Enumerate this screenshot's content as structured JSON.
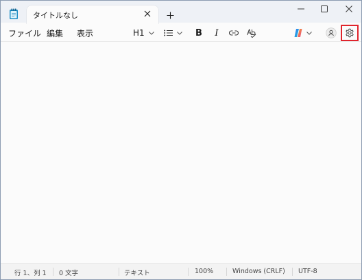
{
  "tab": {
    "title": "タイトルなし"
  },
  "menu": {
    "file": "ファイル",
    "edit": "編集",
    "view": "表示"
  },
  "toolbar": {
    "heading_label": "H1",
    "bold_label": "B",
    "italic_label": "I"
  },
  "editor": {
    "content": ""
  },
  "status": {
    "position": "行 1、列 1",
    "char_count": "0 文字",
    "format": "テキスト",
    "zoom": "100%",
    "line_ending": "Windows (CRLF)",
    "encoding": "UTF-8"
  },
  "colors": {
    "highlight": "#e0242c",
    "titlebar": "#eef1f6",
    "app_icon": "#1f8fc6"
  },
  "icons": {
    "app": "notepad-icon",
    "settings": "gear-icon",
    "account": "account-icon",
    "copilot": "copilot-icon",
    "link": "link-icon",
    "spell": "spellcheck-icon",
    "list": "list-icon"
  }
}
